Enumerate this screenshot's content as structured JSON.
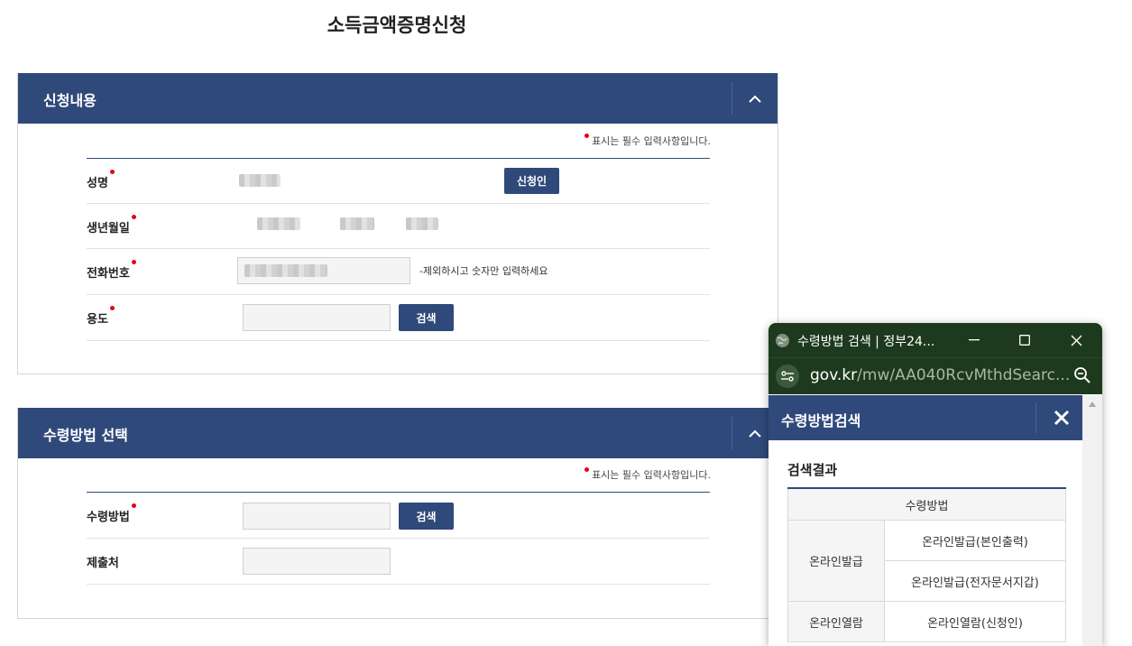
{
  "page": {
    "title": "소득금액증명신청"
  },
  "application": {
    "header": "신청내용",
    "required_note": "표시는 필수 입력사항입니다.",
    "fields": {
      "name": {
        "label": "성명",
        "applicant_button": "신청인"
      },
      "birthdate": {
        "label": "생년월일"
      },
      "phone": {
        "label": "전화번호",
        "hint": "-제외하시고 숫자만 입력하세요"
      },
      "purpose": {
        "label": "용도",
        "search_button": "검색"
      }
    }
  },
  "receipt": {
    "header": "수령방법 선택",
    "required_note": "표시는 필수 입력사항입니다.",
    "fields": {
      "method": {
        "label": "수령방법",
        "search_button": "검색"
      },
      "submit_to": {
        "label": "제출처"
      }
    }
  },
  "popup": {
    "window_title": "수령방법 검색 | 정부24...",
    "url_domain": "gov.kr",
    "url_path": "/mw/AA040RcvMthdSearc...",
    "header": "수령방법검색",
    "result_title": "검색결과",
    "table": {
      "column_header": "수령방법",
      "groups": [
        {
          "name": "온라인발급",
          "items": [
            "온라인발급(본인출력)",
            "온라인발급(전자문서지갑)"
          ]
        },
        {
          "name": "온라인열람",
          "items": [
            "온라인열람(신청인)"
          ]
        }
      ]
    }
  },
  "colors": {
    "header_blue": "#2f4a7a",
    "required_dot": "#e60012",
    "popup_frame": "#1e3a1e"
  }
}
